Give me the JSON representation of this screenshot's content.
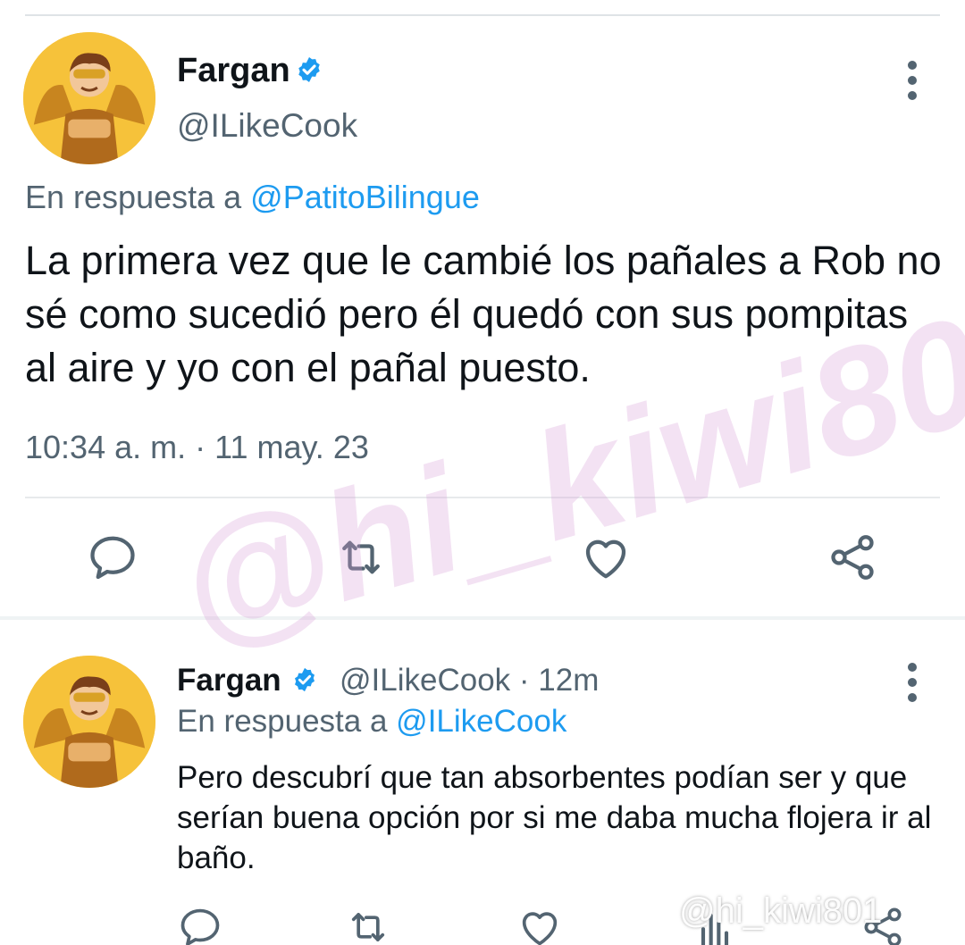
{
  "tweet": {
    "author_name": "Fargan",
    "author_handle": "@ILikeCook",
    "reply_prefix": "En respuesta a",
    "reply_mention": "@PatitoBilingue",
    "text": "La primera vez que le cambié los pañales a Rob no sé como sucedió pero él quedó con sus pompitas al aire y yo con el pañal puesto.",
    "timestamp": "10:34 a. m. · 11 may. 23"
  },
  "reply": {
    "author_name": "Fargan",
    "author_handle": "@ILikeCook",
    "time_ago": "· 12m",
    "reply_prefix": "En respuesta a",
    "reply_mention": "@ILikeCook",
    "text": "Pero descubrí que tan absorbentes podían ser y que serían buena opción por si me daba mucha flojera ir al baño."
  },
  "actions": [
    "reply-icon",
    "retweet-icon",
    "like-icon",
    "share-icon"
  ],
  "watermark": "@hi_kiwi801",
  "watermark_small": "@hi_kiwi801",
  "colors": {
    "link": "#1d9bf0",
    "secondary_text": "#536471",
    "primary_text": "#0f1419",
    "verified": "#1d9bf0",
    "avatar_bg": "#f6c23a"
  }
}
